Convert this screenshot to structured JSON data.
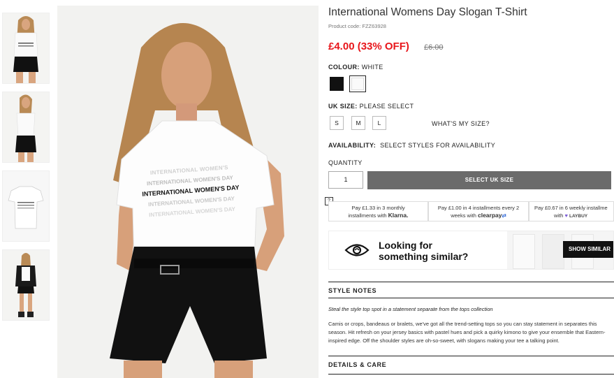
{
  "product": {
    "title": "International Womens Day Slogan T-Shirt",
    "code": "Product code: FZZ63928",
    "price": "£4.00 (33% OFF)",
    "old_price": "£6.00"
  },
  "colour": {
    "label": "COLOUR:",
    "value": "WHITE",
    "swatches": [
      "#111111",
      "#ffffff"
    ]
  },
  "size": {
    "label": "UK SIZE:",
    "value": "PLEASE SELECT",
    "options": [
      "S",
      "M",
      "L"
    ],
    "guide": "WHAT'S MY SIZE?"
  },
  "availability": {
    "label": "AVAILABILITY:",
    "value": "SELECT STYLES FOR AVAILABILITY"
  },
  "quantity": {
    "label": "QUANTITY",
    "value": "1"
  },
  "add_button": "SELECT UK SIZE",
  "payments": {
    "help": "?",
    "klarna_line1": "Pay £1.33 in 3 monthly",
    "klarna_line2": "installments with",
    "klarna_brand": "Klarna.",
    "clearpay_line1": "Pay £1.00 in 4 installments every 2",
    "clearpay_line2": "weeks with",
    "clearpay_brand": "clearpay",
    "laybuy_line1": "Pay £0.67 in 6 weekly installme",
    "laybuy_line2": "with",
    "laybuy_brand": "LAYBUY"
  },
  "similar": {
    "line1": "Looking for",
    "line2": "something similar?",
    "button": "SHOW SIMILAR"
  },
  "style_notes": {
    "heading": "STYLE NOTES",
    "tagline": "Steal the style top spot in a statement separate from the tops collection",
    "body": "Camis or crops, bandeaus or bralets, we've got all the trend-setting tops so you can stay statement in separates this season. Hit refresh on your jersey basics with pastel hues and pick a quirky kimono to give your ensemble that Eastern-inspired edge. Off the shoulder styles are oh-so-sweet, with slogans making your tee a talking point."
  },
  "details_heading": "DETAILS & CARE",
  "tshirt_print": [
    "INTERNATIONAL WOMEN'S",
    "INTERNATIONAL WOMEN'S DAY",
    "INTERNATIONAL WOMEN'S DAY",
    "INTERNATIONAL WOMEN'S DAY",
    "INTERNATIONAL WOMEN'S DAY"
  ]
}
